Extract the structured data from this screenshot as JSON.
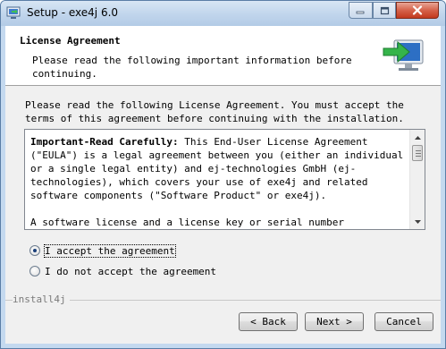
{
  "window": {
    "title": "Setup - exe4j 6.0",
    "controls": [
      "minimize",
      "maximize",
      "close"
    ]
  },
  "header": {
    "title": "License Agreement",
    "subtitle": "Please read the following important information before continuing.",
    "icon": "install-monitor-arrow-icon"
  },
  "body": {
    "instructions": "Please read the following License Agreement. You must accept the terms of this agreement before continuing with the installation."
  },
  "license": {
    "heading": "Important-Read Carefully:",
    "paragraph1": " This End-User License Agreement (\"EULA\") is a legal agreement between you (either an individual or a single legal entity) and ej-technologies GmbH (ej-technologies), which covers your use of exe4j and related software components (\"Software Product\" or exe4j).",
    "paragraph2": "A software license and a license key or serial number (\"Software"
  },
  "options": {
    "selected": "accept",
    "accept_label": "I accept the agreement",
    "decline_label": "I do not accept the agreement"
  },
  "footer": {
    "brand": "install4j",
    "back_label": "< Back",
    "next_label": "Next >",
    "cancel_label": "Cancel"
  },
  "colors": {
    "title_bar": "#c0d5ec",
    "close_button": "#c2391e",
    "client_bg": "#f0f0f0",
    "icon_green": "#2fa84f"
  }
}
